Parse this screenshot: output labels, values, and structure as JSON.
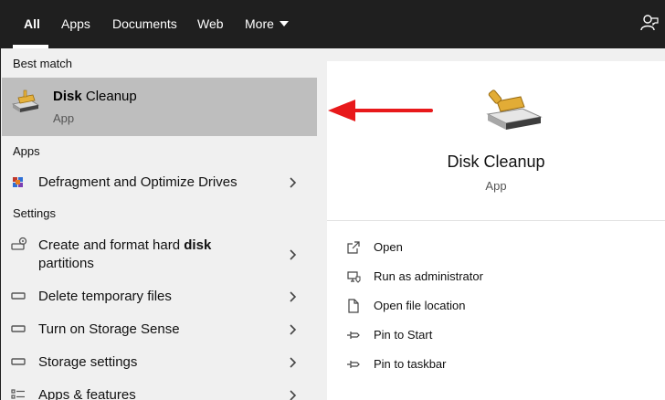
{
  "tabs": [
    {
      "label": "All"
    },
    {
      "label": "Apps"
    },
    {
      "label": "Documents"
    },
    {
      "label": "Web"
    },
    {
      "label": "More"
    }
  ],
  "left": {
    "best_match_label": "Best match",
    "best": {
      "title_bold": "Disk",
      "title_rest": " Cleanup",
      "subtitle": "App",
      "icon": "disk-cleanup-icon"
    },
    "apps_label": "Apps",
    "apps": [
      {
        "label": "Defragment and Optimize Drives",
        "icon": "defrag-icon"
      }
    ],
    "settings_label": "Settings",
    "settings": [
      {
        "label_pre": "Create and format hard ",
        "label_bold": "disk",
        "label_line2": "partitions",
        "icon": "disk-management-icon"
      },
      {
        "label": "Delete temporary files",
        "icon": "storage-icon"
      },
      {
        "label": "Turn on Storage Sense",
        "icon": "storage-icon"
      },
      {
        "label": "Storage settings",
        "icon": "storage-icon"
      },
      {
        "label": "Apps & features",
        "icon": "apps-features-icon"
      }
    ]
  },
  "right": {
    "title": "Disk Cleanup",
    "subtitle": "App",
    "actions": [
      {
        "label": "Open",
        "icon": "open-icon"
      },
      {
        "label": "Run as administrator",
        "icon": "shield-admin-icon"
      },
      {
        "label": "Open file location",
        "icon": "file-location-icon"
      },
      {
        "label": "Pin to Start",
        "icon": "pin-icon"
      },
      {
        "label": "Pin to taskbar",
        "icon": "pin-icon"
      }
    ]
  },
  "colors": {
    "accent_arrow": "#e8191b",
    "topbar": "#1f1f1f",
    "selected": "#bebebe"
  }
}
